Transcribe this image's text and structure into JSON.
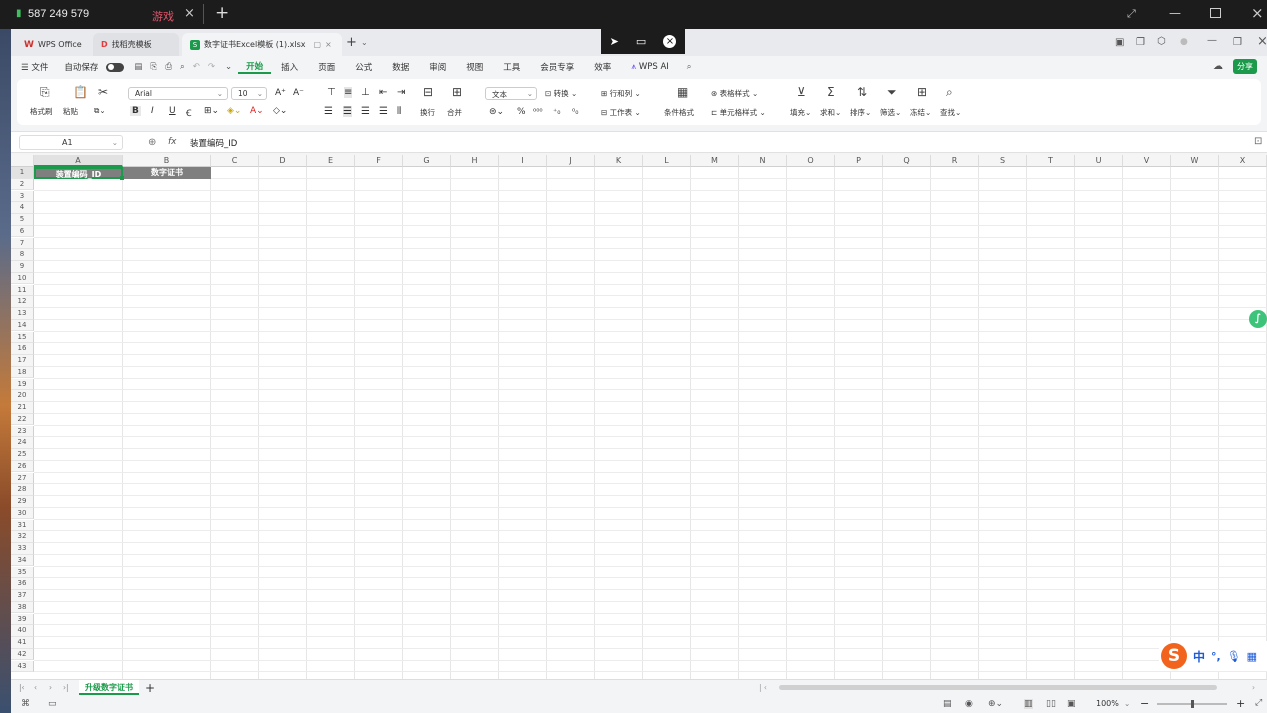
{
  "remote": {
    "connection_label": "587 249 579",
    "session_tab": "游戏"
  },
  "tabs": [
    {
      "label": "WPS Office"
    },
    {
      "label": "找稻壳模板"
    },
    {
      "label": "数字证书Excel模板 (1).xlsx"
    }
  ],
  "menu": {
    "file": "文件",
    "autosave": "自动保存",
    "items": [
      "开始",
      "插入",
      "页面",
      "公式",
      "数据",
      "审阅",
      "视图",
      "工具",
      "会员专享",
      "效率"
    ],
    "ai": "WPS AI",
    "share": "分享"
  },
  "ribbon": {
    "format_painter": "格式刷",
    "paste": "粘贴",
    "font_name": "Arial",
    "font_size": "10",
    "wrap": "换行",
    "merge": "合并",
    "number_format": "文本",
    "convert": "转换",
    "rows_cols": "行和列",
    "worksheet": "工作表",
    "cond_format": "条件格式",
    "table_style": "表格样式",
    "cell_style": "单元格样式",
    "fill": "填充",
    "sum": "求和",
    "sort": "排序",
    "filter": "筛选",
    "freeze": "冻结",
    "find": "查找"
  },
  "formula": {
    "cell_ref": "A1",
    "fx": "fx",
    "content": "装置编码_ID"
  },
  "grid": {
    "columns": [
      "A",
      "B",
      "C",
      "D",
      "E",
      "F",
      "G",
      "H",
      "I",
      "J",
      "K",
      "L",
      "M",
      "N",
      "O",
      "P",
      "Q",
      "R",
      "S",
      "T",
      "U",
      "V",
      "W",
      "X"
    ],
    "header_cells": [
      "装置编码_ID",
      "数字证书"
    ],
    "row_count": 43
  },
  "sheet": {
    "tab_name": "升级数字证书",
    "add": "+"
  },
  "status": {
    "zoom": "100%"
  },
  "ime": {
    "lang": "中"
  },
  "colors": {
    "accent_green": "#1a9a4a",
    "header_cell_bg": "#7f7f7f"
  }
}
